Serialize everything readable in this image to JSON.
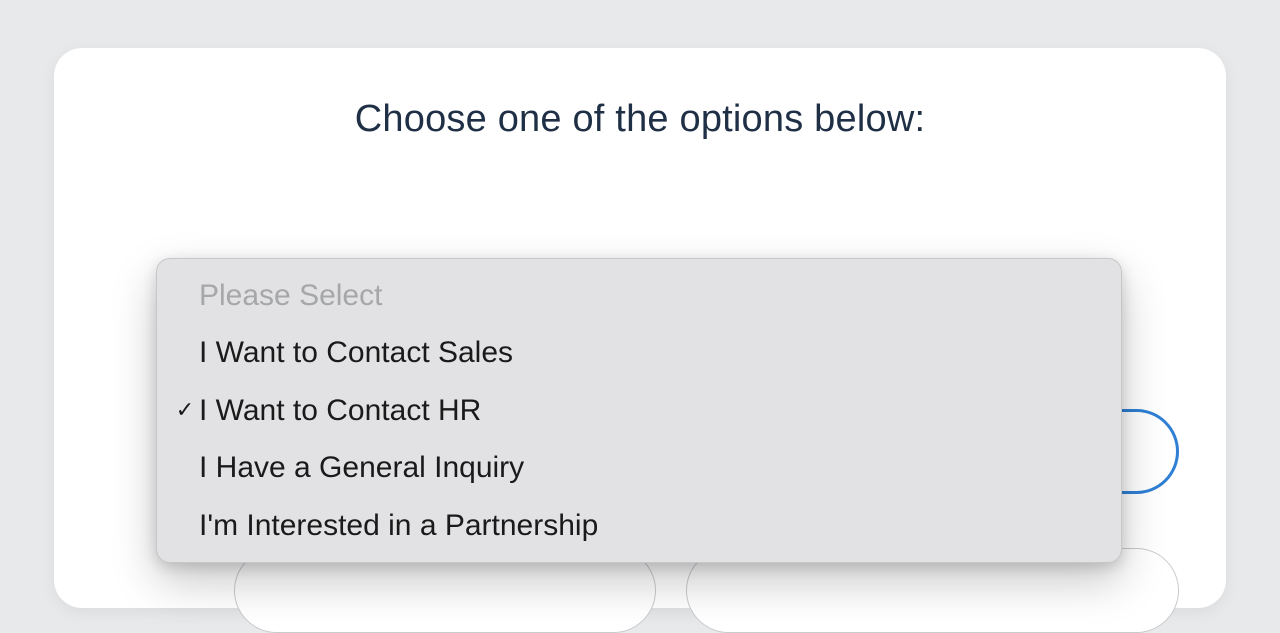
{
  "title": "Choose one of the options below:",
  "select": {
    "placeholder": "Please Select",
    "options": [
      "I Want to Contact Sales",
      "I Want to Contact HR",
      "I Have a General Inquiry",
      "I'm Interested in a Partnership"
    ],
    "selected_index": 1
  },
  "icons": {
    "check": "✓"
  }
}
